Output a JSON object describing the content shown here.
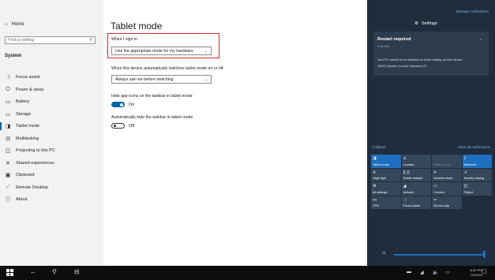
{
  "sidebar": {
    "home": "Home",
    "search_placeholder": "Find a setting",
    "section": "System",
    "items": [
      {
        "label": "Focus assist",
        "icon": "moon-icon",
        "glyph": "☽"
      },
      {
        "label": "Power & sleep",
        "icon": "power-icon",
        "glyph": "⏻"
      },
      {
        "label": "Battery",
        "icon": "battery-icon",
        "glyph": "▭"
      },
      {
        "label": "Storage",
        "icon": "storage-icon",
        "glyph": "▭"
      },
      {
        "label": "Tablet mode",
        "icon": "tablet-icon",
        "glyph": "◨"
      },
      {
        "label": "Multitasking",
        "icon": "multitask-icon",
        "glyph": "⊟"
      },
      {
        "label": "Projecting to this PC",
        "icon": "project-icon",
        "glyph": "◫"
      },
      {
        "label": "Shared experiences",
        "icon": "shared-icon",
        "glyph": "✕"
      },
      {
        "label": "Clipboard",
        "icon": "clipboard-icon",
        "glyph": "▣"
      },
      {
        "label": "Remote Desktop",
        "icon": "remote-icon",
        "glyph": "⟋"
      },
      {
        "label": "About",
        "icon": "info-icon",
        "glyph": "ⓘ"
      }
    ]
  },
  "main": {
    "title": "Tablet mode",
    "signin_label": "When I sign in",
    "signin_value": "Use the appropriate mode for my hardware",
    "switch_label": "When this device automatically switches tablet mode on or off",
    "switch_value": "Always ask me before switching",
    "hide_icons_label": "Hide app icons on the taskbar in tablet mode",
    "hide_icons_state": "On",
    "auto_hide_label": "Automatically hide the taskbar in tablet mode",
    "auto_hide_state": "Off"
  },
  "action_center": {
    "manage": "Manage notifications",
    "settings": "Settings",
    "notification": {
      "title": "Restart required",
      "time": "9:46 AM",
      "body1": "Your PC needs to be restarted to finish setting up this device:",
      "body2": "ASUS System Control Interface V2"
    },
    "collapse": "Collapse",
    "clear": "Clear all notifications",
    "tiles": [
      {
        "label": "Tablet mode",
        "icon": "tablet-mode-icon",
        "glyph": "◨",
        "on": true,
        "dim": false
      },
      {
        "label": "Location",
        "icon": "location-icon",
        "glyph": "♙",
        "on": false,
        "dim": false
      },
      {
        "label": "Battery saver",
        "icon": "battery-saver-icon",
        "glyph": "♀",
        "on": false,
        "dim": true
      },
      {
        "label": "Bluetooth",
        "icon": "bluetooth-icon",
        "glyph": "ᛒ",
        "on": true,
        "dim": false
      },
      {
        "label": "Night light",
        "icon": "night-light-icon",
        "glyph": "☀",
        "on": false,
        "dim": false
      },
      {
        "label": "Mobile hotspot",
        "icon": "hotspot-icon",
        "glyph": "((·))",
        "on": false,
        "dim": false
      },
      {
        "label": "Airplane mode",
        "icon": "airplane-icon",
        "glyph": "✈",
        "on": false,
        "dim": false
      },
      {
        "label": "Nearby sharing",
        "icon": "nearby-sharing-icon",
        "glyph": "⇗",
        "on": false,
        "dim": false
      },
      {
        "label": "All settings",
        "icon": "gear-icon",
        "glyph": "⚙",
        "on": false,
        "dim": false
      },
      {
        "label": "Network",
        "icon": "network-icon",
        "glyph": "◢",
        "on": false,
        "dim": false
      },
      {
        "label": "Connect",
        "icon": "connect-icon",
        "glyph": "▭",
        "on": false,
        "dim": false
      },
      {
        "label": "Project",
        "icon": "project-screen-icon",
        "glyph": "◫",
        "on": false,
        "dim": false
      },
      {
        "label": "VPN",
        "icon": "vpn-icon",
        "glyph": "⊶",
        "on": false,
        "dim": false
      },
      {
        "label": "Focus assist",
        "icon": "focus-assist-icon",
        "glyph": "☽",
        "on": false,
        "dim": false
      },
      {
        "label": "Screen snip",
        "icon": "screen-snip-icon",
        "glyph": "✂",
        "on": false,
        "dim": false
      }
    ],
    "brightness_level": 1.0
  },
  "taskbar": {
    "time": "8:52 PM",
    "date": "7/2/2020"
  }
}
